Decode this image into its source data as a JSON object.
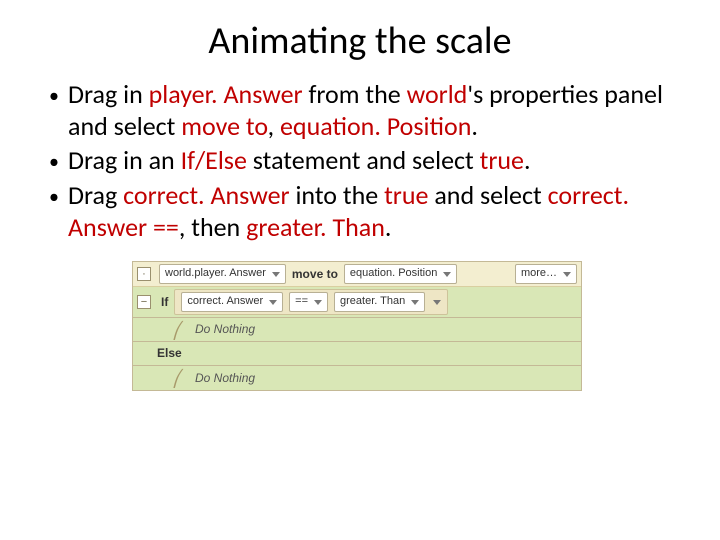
{
  "title": "Animating the scale",
  "bullets": {
    "b1": {
      "t1": "Drag in ",
      "r1": "player. Answer ",
      "t2": "from the ",
      "r2": "world",
      "t3": "'s properties panel and select ",
      "r3": "move to",
      "t4": ", ",
      "r4": "equation. Position",
      "t5": "."
    },
    "b2": {
      "t1": "Drag in an ",
      "r1": "If/Else ",
      "t2": "statement and select ",
      "r2": "true",
      "t3": "."
    },
    "b3": {
      "t1": "Drag ",
      "r1": "correct. Answer ",
      "t2": "into the ",
      "r2": "true ",
      "t3": "and select ",
      "r3": "correct. Answer ==",
      "t4": ", then ",
      "r4": "greater. Than",
      "t5": "."
    }
  },
  "alice": {
    "row1": {
      "chip1": "world.player. Answer",
      "label": "move to",
      "chip2": "equation. Position",
      "more": "more…"
    },
    "row2": {
      "minus": "−",
      "if": "If",
      "chip1": "correct. Answer",
      "chip_eq": "==",
      "chip2": "greater. Than"
    },
    "row3": {
      "text": "Do Nothing"
    },
    "row4": {
      "else": "Else"
    },
    "row5": {
      "text": "Do Nothing"
    }
  }
}
